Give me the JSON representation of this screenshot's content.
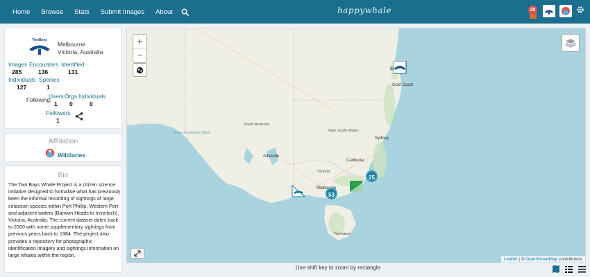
{
  "nav": {
    "items": [
      "Home",
      "Browse",
      "Stats",
      "Submit Images",
      "About"
    ],
    "brand": "happywhale",
    "notification_count": "20"
  },
  "profile": {
    "location_city": "Melbourne",
    "location_region": "Victoria, Australia",
    "stats": {
      "images_label": "Images",
      "images": "285",
      "encounters_label": "Encounters",
      "encounters": "136",
      "identified_label": "Identified",
      "identified": "131",
      "individuals_label": "Individuals",
      "individuals": "127",
      "species_label": "Species",
      "species": "1"
    },
    "following": {
      "label": "Following:",
      "users_label": "Users",
      "users": "1",
      "orgs_label": "Orgs",
      "orgs": "0",
      "individuals_label": "Individuals",
      "individuals": "0"
    },
    "followers_label": "Followers",
    "followers": "1"
  },
  "affiliation": {
    "title": "Affiliation",
    "name": "Wildiaries"
  },
  "bio": {
    "title": "Bio",
    "text": "The Two Bays Whale Project is a citizen science initiative designed to formalise what has previously been the informal recording of sightings of large cetacean species within Port Phillip, Western Port and adjacent waters (Barwon Heads to Inverloch), Victoria, Australia. The current dataset dates back to 2000 with some supplementary sightings from previous years back to 1984. The project also provides a repository for photographic identification imagery and sightings information on large whales within the region."
  },
  "map": {
    "zoom_in": "+",
    "zoom_out": "−",
    "clusters": [
      "53",
      "25"
    ],
    "labels": {
      "south_australia": "South Australia",
      "new_south_wales": "New South Wales",
      "victoria": "Victoria",
      "tasmania": "Tasmania",
      "bight": "Great Australian Bight",
      "adelaide": "Adelaide",
      "melbourne": "Melbourne",
      "canberra": "Canberra",
      "sydney": "Sydney",
      "brisbane": "Brisbane",
      "gold_coast": "Gold Coast"
    },
    "attribution_leaflet": "Leaflet",
    "attribution_sep": " | © ",
    "attribution_osm": "OpenStreetMap",
    "attribution_rest": " contributors"
  },
  "footer": {
    "hint": "Use shift key to zoom by rectangle"
  },
  "colors": {
    "nav": "#1b6f8e",
    "accent": "#1b6f8e",
    "cluster": "#1f7f9f",
    "water": "#a9d3df",
    "land": "#efefe6"
  }
}
